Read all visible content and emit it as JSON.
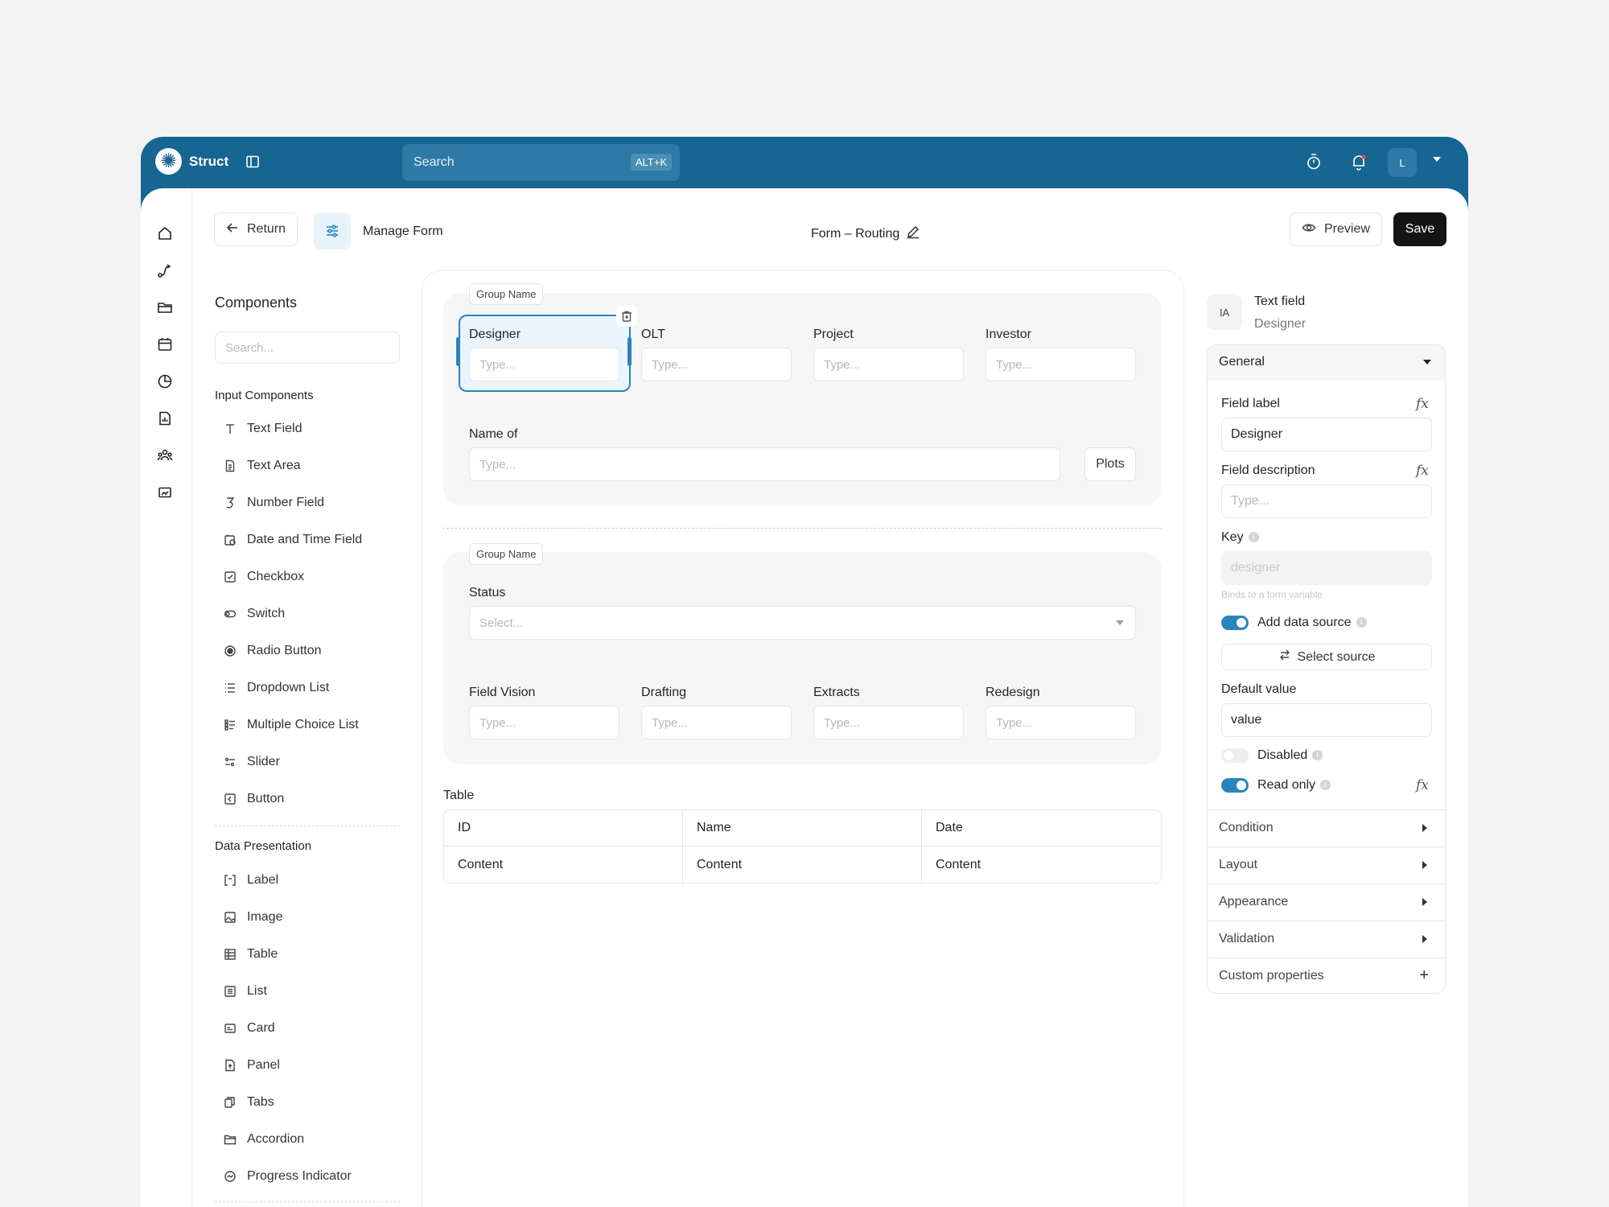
{
  "app": {
    "brand": "Struct",
    "search_label": "Search",
    "search_shortcut": "ALT+K",
    "avatar_initial": "L"
  },
  "header": {
    "return_label": "Return",
    "manage_title": "Manage Form",
    "form_title": "Form – Routing",
    "preview_label": "Preview",
    "save_label": "Save"
  },
  "components": {
    "title": "Components",
    "search_placeholder": "Search...",
    "input_section": "Input Components",
    "input_items": [
      {
        "label": "Text Field",
        "icon": "text-icon"
      },
      {
        "label": "Text Area",
        "icon": "document-icon"
      },
      {
        "label": "Number Field",
        "icon": "number-icon"
      },
      {
        "label": "Date and Time Field",
        "icon": "calendar-clock-icon"
      },
      {
        "label": "Checkbox",
        "icon": "checkbox-icon"
      },
      {
        "label": "Switch",
        "icon": "switch-icon"
      },
      {
        "label": "Radio Button",
        "icon": "radio-icon"
      },
      {
        "label": "Dropdown List",
        "icon": "list-icon"
      },
      {
        "label": "Multiple Choice List",
        "icon": "multi-list-icon"
      },
      {
        "label": "Slider",
        "icon": "slider-icon"
      },
      {
        "label": "Button",
        "icon": "button-icon"
      }
    ],
    "data_section": "Data Presentation",
    "data_items": [
      {
        "label": "Label",
        "icon": "label-icon"
      },
      {
        "label": "Image",
        "icon": "image-icon"
      },
      {
        "label": "Table",
        "icon": "table-icon"
      },
      {
        "label": "List",
        "icon": "list-box-icon"
      },
      {
        "label": "Card",
        "icon": "card-icon"
      },
      {
        "label": "Panel",
        "icon": "panel-icon"
      },
      {
        "label": "Tabs",
        "icon": "tabs-icon"
      },
      {
        "label": "Accordion",
        "icon": "folder-icon"
      },
      {
        "label": "Progress Indicator",
        "icon": "progress-icon"
      }
    ]
  },
  "canvas": {
    "group1": {
      "tag": "Group Name",
      "fields": [
        {
          "label": "Designer",
          "placeholder": "Type..."
        },
        {
          "label": "OLT",
          "placeholder": "Type..."
        },
        {
          "label": "Project",
          "placeholder": "Type..."
        },
        {
          "label": "Investor",
          "placeholder": "Type..."
        }
      ],
      "name_of_label": "Name of",
      "name_of_placeholder": "Type...",
      "plots_label": "Plots"
    },
    "group2": {
      "tag": "Group Name",
      "status_label": "Status",
      "status_placeholder": "Select...",
      "fields": [
        {
          "label": "Field Vision",
          "placeholder": "Type..."
        },
        {
          "label": "Drafting",
          "placeholder": "Type..."
        },
        {
          "label": "Extracts",
          "placeholder": "Type..."
        },
        {
          "label": "Redesign",
          "placeholder": "Type..."
        }
      ]
    },
    "table": {
      "title": "Table",
      "headers": [
        "ID",
        "Name",
        "Date"
      ],
      "rows": [
        [
          "Content",
          "Content",
          "Content"
        ]
      ]
    }
  },
  "properties": {
    "type_icon_text": "IA",
    "title": "Text field",
    "subtitle": "Designer",
    "general_label": "General",
    "field_label_label": "Field label",
    "field_label_value": "Designer",
    "field_description_label": "Field description",
    "field_description_placeholder": "Type...",
    "key_label": "Key",
    "key_placeholder": "designer",
    "key_hint": "Binds to a form variable",
    "add_data_source_label": "Add data source",
    "add_data_source_on": true,
    "select_source_label": "Select source",
    "default_value_label": "Default value",
    "default_value": "value",
    "disabled_label": "Disabled",
    "disabled_on": false,
    "read_only_label": "Read only",
    "read_only_on": true,
    "fx": "fx",
    "sections": [
      "Condition",
      "Layout",
      "Appearance",
      "Validation"
    ],
    "custom_properties_label": "Custom properties"
  },
  "colors": {
    "brand": "#176593",
    "accent": "#2a84bd",
    "save_bg": "#141414"
  }
}
